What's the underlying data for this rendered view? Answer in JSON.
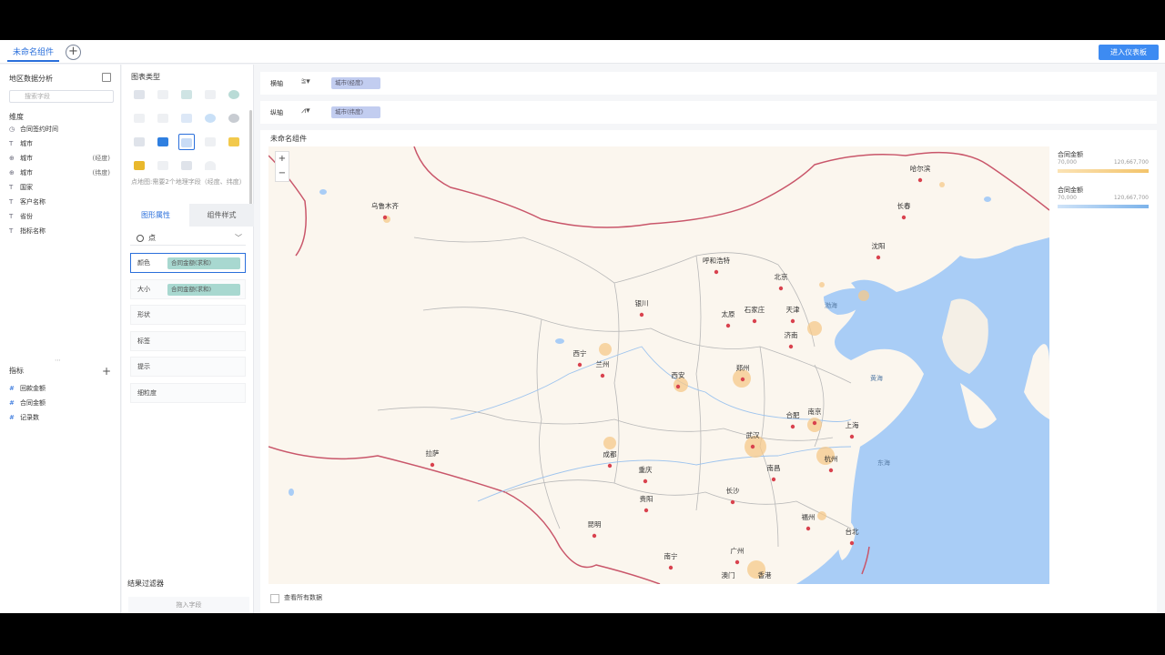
{
  "topbar": {
    "tab_label": "未命名组件",
    "add_tab": "+",
    "enter_button": "进入仪表板"
  },
  "dataset": {
    "title": "地区数据分析",
    "search_placeholder": "搜索字段",
    "dimension_label": "维度",
    "dimensions": [
      {
        "icon": "date",
        "label": "合同签约时间",
        "extra": ""
      },
      {
        "icon": "text",
        "label": "城市",
        "extra": ""
      },
      {
        "icon": "geo",
        "label": "城市",
        "extra": "(经度)"
      },
      {
        "icon": "geo",
        "label": "城市",
        "extra": "(纬度)"
      },
      {
        "icon": "text",
        "label": "国家",
        "extra": ""
      },
      {
        "icon": "text",
        "label": "客户名称",
        "extra": ""
      },
      {
        "icon": "text",
        "label": "省份",
        "extra": ""
      },
      {
        "icon": "text",
        "label": "指标名称",
        "extra": ""
      }
    ],
    "measure_label": "指标",
    "measures": [
      {
        "icon": "#",
        "label": "回款金额"
      },
      {
        "icon": "#",
        "label": "合同金额"
      },
      {
        "icon": "#",
        "label": "记录数"
      }
    ]
  },
  "config": {
    "chart_type_title": "图表类型",
    "hint": "点地图:需要2个地理字段（经度、纬度）",
    "tab_shape": "图形属性",
    "tab_style": "组件样式",
    "mark_type": "点",
    "props": [
      {
        "label": "颜色",
        "pill": "合同金额(求和)"
      },
      {
        "label": "大小",
        "pill": "合同金额(求和)"
      },
      {
        "label": "形状",
        "pill": ""
      },
      {
        "label": "标签",
        "pill": ""
      },
      {
        "label": "提示",
        "pill": ""
      },
      {
        "label": "细粒度",
        "pill": ""
      }
    ],
    "filter_title": "结果过滤器",
    "filter_drop": "拖入字段"
  },
  "axes": {
    "x_label": "横轴",
    "x_field": "城市(经度)",
    "y_label": "纵轴",
    "y_field": "城市(纬度)"
  },
  "chart": {
    "title": "未命名组件",
    "zoom_in": "+",
    "zoom_out": "−",
    "legend": [
      {
        "title": "合同金额",
        "min": "70,000",
        "max": "120,667,700",
        "color": "#f3c46b"
      },
      {
        "title": "合同金额",
        "min": "70,000",
        "max": "120,667,700",
        "color": "#7cb3ea"
      }
    ],
    "show_all": "查看所有数据"
  },
  "colors": {
    "accent": "#2a6fdb",
    "button": "#3d8bf2",
    "sea": "#a9cdf6",
    "land": "#fbf6ee",
    "bubble": "#f6c98a"
  },
  "map_labels": {
    "harbin": "哈尔滨",
    "urumqi": "乌鲁木齐",
    "changchun": "长春",
    "shenyang": "沈阳",
    "hohhot": "呼和浩特",
    "beijing": "北京",
    "tianjin": "天津",
    "shijiazhuang": "石家庄",
    "taiyuan": "太原",
    "yinchuan": "银川",
    "jinan": "济南",
    "xining": "西宁",
    "lanzhou": "兰州",
    "xian": "西安",
    "zhengzhou": "郑州",
    "hefei": "合肥",
    "nanjing": "南京",
    "shanghai": "上海",
    "lhasa": "拉萨",
    "chengdu": "成都",
    "wuhan": "武汉",
    "hangzhou": "杭州",
    "chongqing": "重庆",
    "changsha": "长沙",
    "nanchang": "南昌",
    "guiyang": "贵阳",
    "kunming": "昆明",
    "fuzhou": "福州",
    "taipei": "台北",
    "nanning": "南宁",
    "guangzhou": "广州",
    "macau": "澳门",
    "hongkong": "香港",
    "bohai": "渤海",
    "yellowsea": "黄海",
    "eastsea": "东海"
  }
}
